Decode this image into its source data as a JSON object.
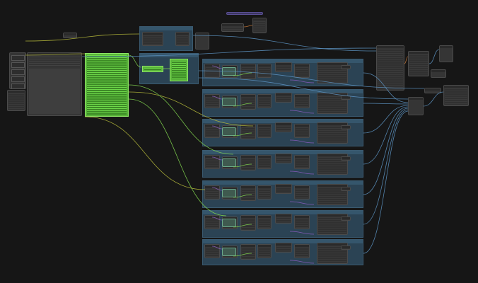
{
  "app": {
    "title": "",
    "canvas_background": "#161616"
  },
  "colors": {
    "group_fill": "#2b4354",
    "node_fill": "#353535",
    "green_node": "#59b43a",
    "wire_yellow": "#b5b83a",
    "wire_blue": "#5a8fbd",
    "wire_green": "#7fd14e",
    "wire_purple": "#8a5cc0",
    "wire_orange": "#c97a3a"
  },
  "groups": [
    {
      "id": "top-group"
    },
    {
      "id": "mid-group"
    },
    {
      "id": "row-1"
    },
    {
      "id": "row-2"
    },
    {
      "id": "row-3"
    },
    {
      "id": "row-4"
    },
    {
      "id": "row-5"
    },
    {
      "id": "row-6"
    },
    {
      "id": "row-7"
    }
  ],
  "left_panel": {
    "buttons": [
      "",
      "",
      "",
      "",
      ""
    ]
  }
}
